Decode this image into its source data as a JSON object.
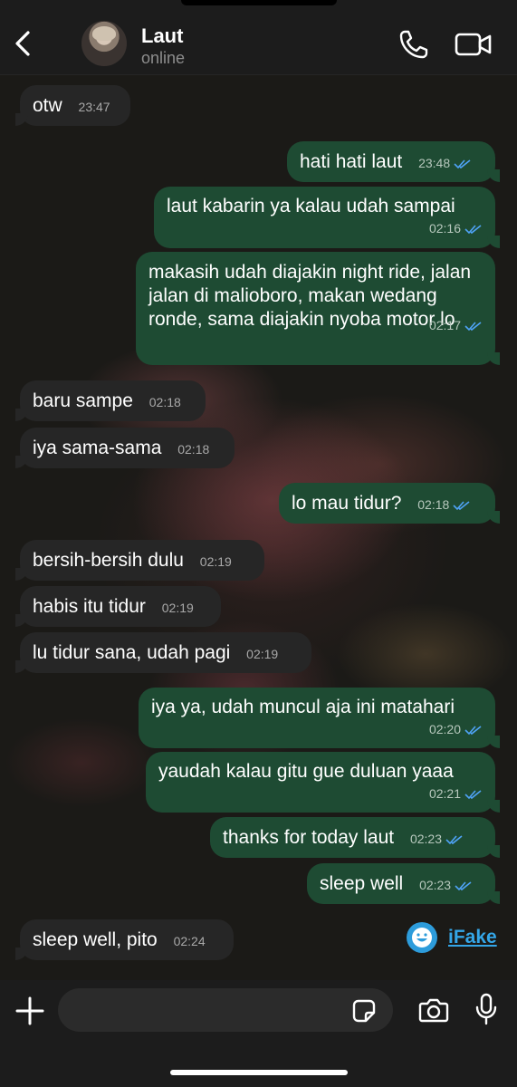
{
  "header": {
    "contact_name": "Laut",
    "contact_status": "online"
  },
  "messages": [
    {
      "dir": "in",
      "text": "otw",
      "time": "23:47"
    },
    {
      "dir": "out",
      "text": "hati hati laut",
      "time": "23:48",
      "read": true
    },
    {
      "dir": "out",
      "text": "laut kabarin ya kalau udah sampai",
      "time": "02:16",
      "read": true
    },
    {
      "dir": "out",
      "text": "makasih udah diajakin night ride, jalan jalan di malioboro, makan wedang ronde, sama diajakin nyoba motor lo",
      "time": "02:17",
      "read": true
    },
    {
      "dir": "in",
      "text": "baru sampe",
      "time": "02:18"
    },
    {
      "dir": "in",
      "text": "iya sama-sama",
      "time": "02:18"
    },
    {
      "dir": "out",
      "text": "lo mau tidur?",
      "time": "02:18",
      "read": true
    },
    {
      "dir": "in",
      "text": "bersih-bersih dulu",
      "time": "02:19"
    },
    {
      "dir": "in",
      "text": "habis itu tidur",
      "time": "02:19"
    },
    {
      "dir": "in",
      "text": "lu tidur sana, udah pagi",
      "time": "02:19"
    },
    {
      "dir": "out",
      "text": "iya ya, udah muncul aja ini matahari",
      "time": "02:20",
      "read": true
    },
    {
      "dir": "out",
      "text": "yaudah kalau gitu gue duluan yaaa",
      "time": "02:21",
      "read": true
    },
    {
      "dir": "out",
      "text": "thanks for today laut",
      "time": "02:23",
      "read": true
    },
    {
      "dir": "out",
      "text": "sleep well",
      "time": "02:23",
      "read": true
    },
    {
      "dir": "in",
      "text": "sleep well, pito",
      "time": "02:24"
    }
  ],
  "watermark": {
    "text": "iFake"
  },
  "composer": {
    "placeholder": ""
  },
  "colors": {
    "outgoing_bubble": "#1e4b33",
    "incoming_bubble": "#262626",
    "read_ticks": "#4fa3f7"
  }
}
